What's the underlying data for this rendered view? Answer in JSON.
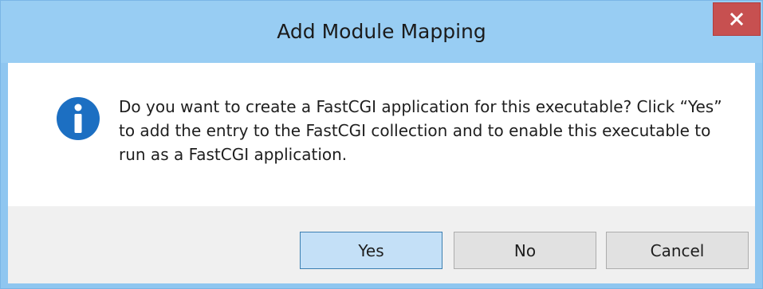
{
  "dialog": {
    "title": "Add Module Mapping",
    "close_icon": "close-icon",
    "message": "Do you want to create a FastCGI application for this executable? Click “Yes” to add the entry to the FastCGI collection and to enable this executable to run as a FastCGI application.",
    "info_icon": "info-icon",
    "buttons": {
      "yes": "Yes",
      "no": "No",
      "cancel": "Cancel"
    },
    "colors": {
      "titlebar": "#98cdf3",
      "close_button": "#c75050",
      "info_icon": "#1c6fc2",
      "default_button": "#c4e0f7"
    }
  }
}
